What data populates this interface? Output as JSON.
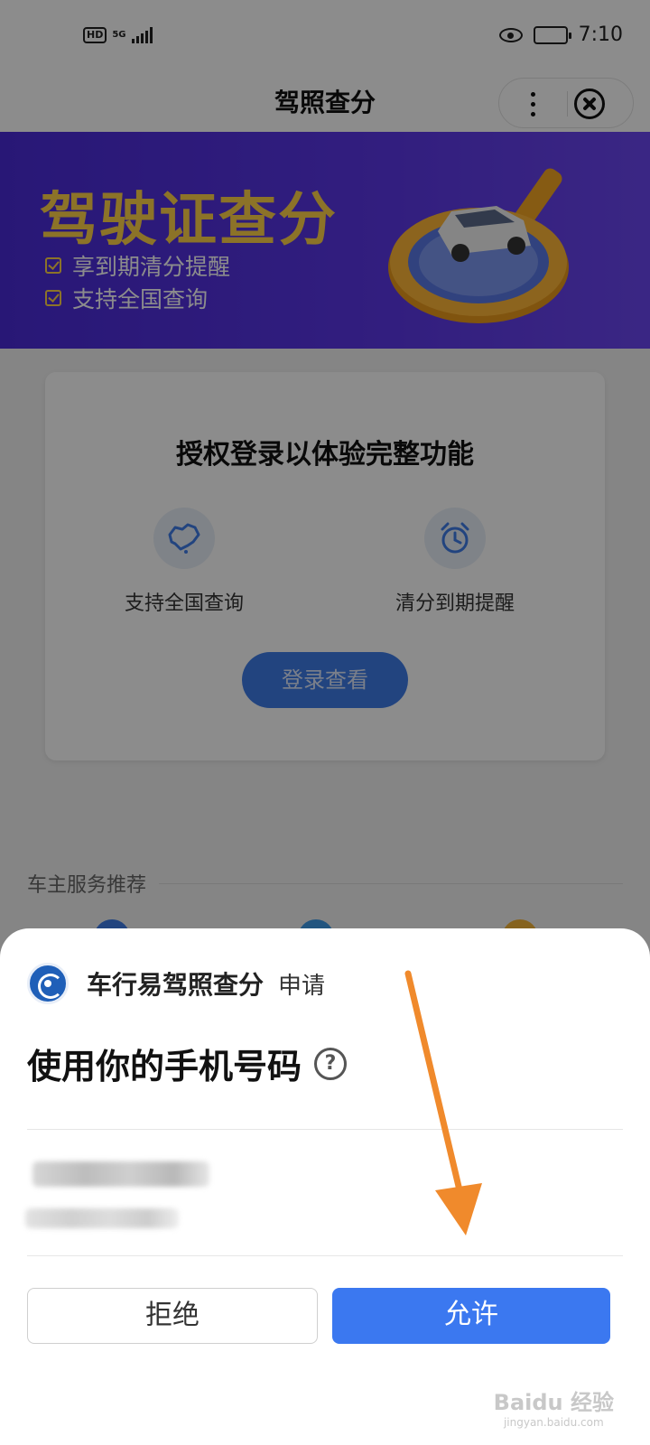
{
  "status_bar": {
    "hd": "HD",
    "network": "5G",
    "time": "7:10",
    "battery_level": 0.5
  },
  "navbar": {
    "title": "驾照查分"
  },
  "banner": {
    "title": "驾驶证查分",
    "features": [
      "享到期清分提醒",
      "支持全国查询"
    ],
    "colors": {
      "title": "#ffd24a",
      "background": "#4a2bd8"
    }
  },
  "card": {
    "title": "授权登录以体验完整功能",
    "features": [
      {
        "icon": "china-map-icon",
        "label": "支持全国查询"
      },
      {
        "icon": "alarm-clock-icon",
        "label": "清分到期提醒"
      }
    ],
    "login_button": "登录查看"
  },
  "section": {
    "title": "车主服务推荐"
  },
  "sheet": {
    "app_name": "车行易驾照查分",
    "apply_label": "申请",
    "title": "使用你的手机号码",
    "help_icon": "?",
    "deny_button": "拒绝",
    "allow_button": "允许",
    "colors": {
      "allow": "#3b78f0"
    }
  },
  "annotation": {
    "icon": "orange-arrow-icon",
    "color": "#f08a2c"
  },
  "watermark": {
    "main": "Baidu 经验",
    "sub": "jingyan.baidu.com"
  }
}
